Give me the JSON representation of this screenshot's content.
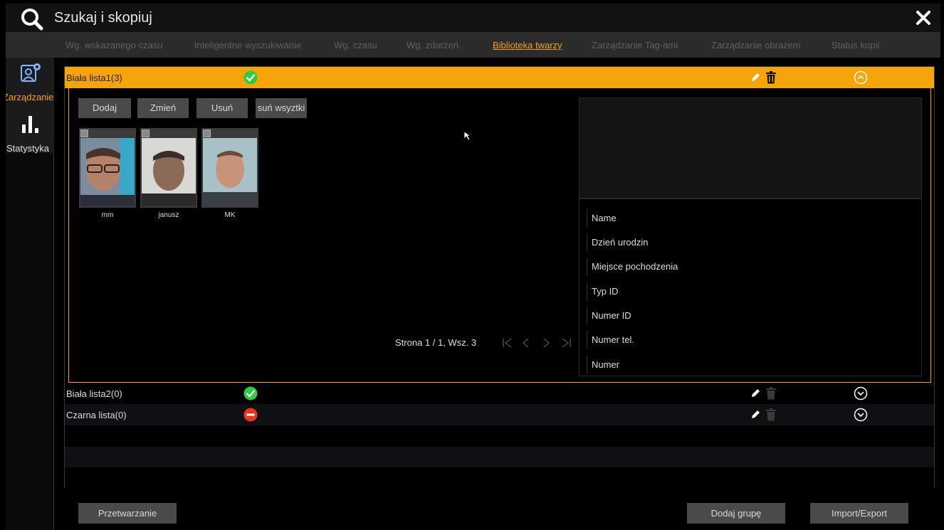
{
  "window": {
    "title": "Szukaj i skopiuj"
  },
  "tabs": [
    {
      "label": "Wg. wskazanego czasu"
    },
    {
      "label": "Inteligentne wyszukiwanie"
    },
    {
      "label": "Wg. czasu"
    },
    {
      "label": "Wg. zdarzeń."
    },
    {
      "label": "Biblioteka twarzy",
      "active": true
    },
    {
      "label": "Zarządzanie Tag-ami"
    },
    {
      "label": "Zarządzanie obrazem"
    },
    {
      "label": "Status kopii"
    }
  ],
  "sidebar": {
    "items": [
      {
        "label": "Zarządzanie",
        "icon": "face-settings-icon",
        "active": true
      },
      {
        "label": "Statystyka",
        "icon": "bar-chart-icon"
      }
    ]
  },
  "groups": [
    {
      "name": "Biała lista1(3)",
      "status": "allow",
      "expanded": true
    },
    {
      "name": "Biała lista2(0)",
      "status": "allow",
      "expanded": false
    },
    {
      "name": "Czarna lista(0)",
      "status": "block",
      "expanded": false
    }
  ],
  "toolbar": {
    "add": "Dodaj",
    "edit": "Zmień",
    "delete": "Usuń",
    "delete_all": "suń wsyztki"
  },
  "faces": [
    {
      "name": "mm"
    },
    {
      "name": "janusz"
    },
    {
      "name": "MK"
    }
  ],
  "pager": {
    "text": "Strona 1 / 1, Wsz. 3"
  },
  "details": {
    "fields": [
      "Name",
      "Dzień urodzin",
      "Miejsce pochodzenia",
      "Typ ID",
      "Numer ID",
      "Numer tel.",
      "Numer"
    ]
  },
  "bottom": {
    "process": "Przetwarzanie",
    "add_group": "Dodaj grupę",
    "import_export": "Import/Export"
  },
  "colors": {
    "accent": "#f5a40a",
    "allow": "#2ecc40",
    "block": "#e8361e",
    "tab_inactive": "#606060"
  }
}
